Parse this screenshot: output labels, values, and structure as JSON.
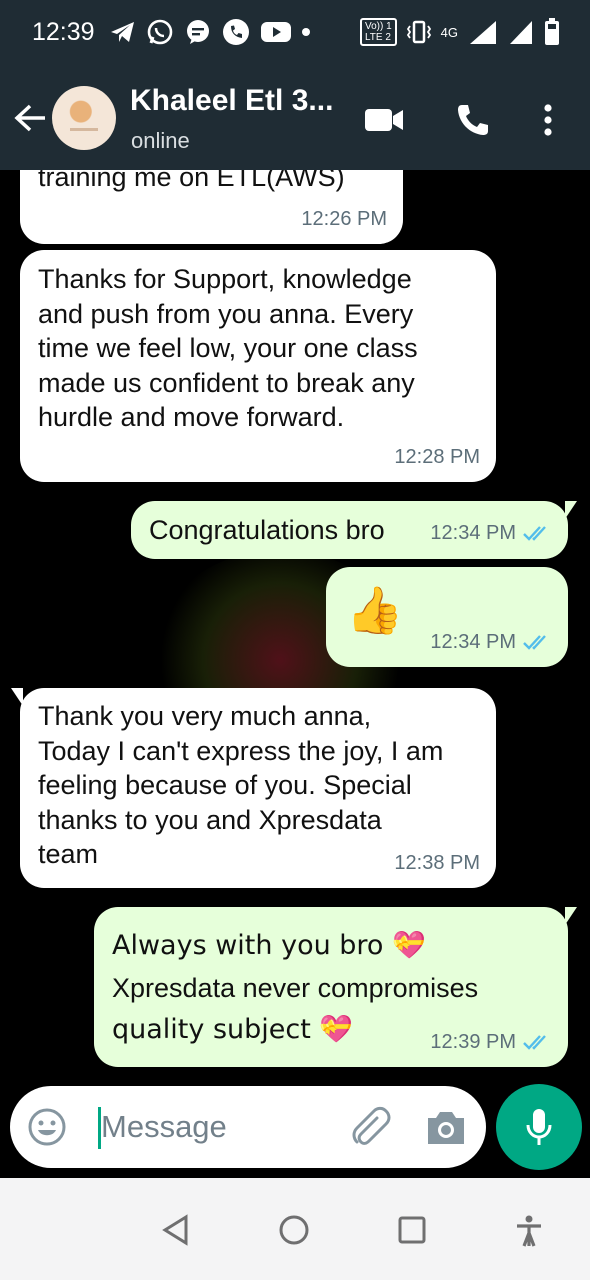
{
  "status_bar": {
    "time": "12:39",
    "volte_line1": "Vo)) 1",
    "volte_line2": "LTE 2",
    "network_type": "4G",
    "icons": [
      "telegram-icon",
      "whatsapp-icon",
      "chat-icon",
      "phone-icon",
      "youtube-icon",
      "dot-icon",
      "vibrate-icon",
      "signal-icon",
      "battery-icon"
    ]
  },
  "header": {
    "contact_name": "Khaleel Etl 3...",
    "status": "online",
    "icons": [
      "back-arrow-icon",
      "avatar",
      "video-call-icon",
      "phone-call-icon",
      "more-vert-icon"
    ]
  },
  "messages": [
    {
      "direction": "incoming",
      "text": [
        "training me on ETL(AWS)"
      ],
      "time": "12:26 PM"
    },
    {
      "direction": "incoming",
      "text": [
        "Thanks for Support, knowledge",
        "and push from you anna. Every",
        "time we feel low, your one class",
        "made us confident to break any",
        "hurdle and move forward."
      ],
      "time": "12:28 PM"
    },
    {
      "direction": "outgoing",
      "text": [
        "Congratulations bro"
      ],
      "time": "12:34 PM",
      "read": true
    },
    {
      "direction": "outgoing",
      "text": [
        "👍"
      ],
      "time": "12:34 PM",
      "read": true
    },
    {
      "direction": "incoming",
      "text": [
        "Thank you very much anna,",
        "Today I can't express the joy, I am",
        "feeling because of you. Special",
        "thanks to you and  Xpresdata",
        "team"
      ],
      "time": "12:38 PM"
    },
    {
      "direction": "outgoing",
      "text": [
        "Always with you bro 💝",
        "Xpresdata never compromises",
        "quality subject 💝"
      ],
      "time": "12:39 PM",
      "read": true
    }
  ],
  "composer": {
    "placeholder": "Message",
    "value": "",
    "icons": [
      "emoji-icon",
      "attach-icon",
      "camera-icon",
      "mic-icon"
    ]
  },
  "nav_bar": {
    "icons": [
      "back-triangle-icon",
      "home-circle-icon",
      "recents-square-icon",
      "accessibility-icon"
    ]
  },
  "colors": {
    "app_bar": "#1f2c34",
    "chat_background": "#000000",
    "incoming_bubble": "#ffffff",
    "outgoing_bubble": "#e6ffda",
    "read_ticks": "#53bdeb",
    "accent": "#00a884"
  }
}
